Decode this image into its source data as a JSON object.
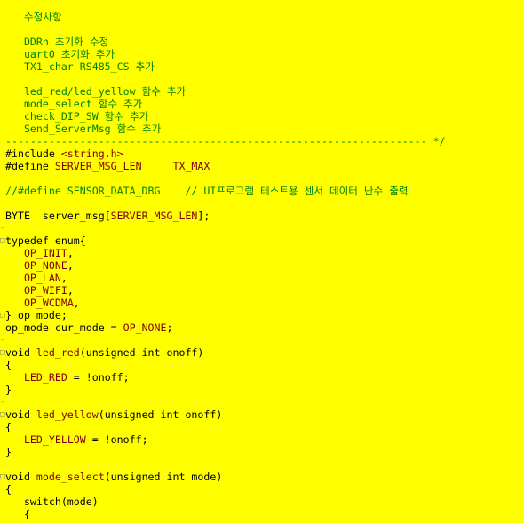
{
  "editor": {
    "background": "#ffff00",
    "colors": {
      "comment": "#008000",
      "macro": "#800000",
      "plain": "#000000"
    },
    "lines": [
      {
        "segs": [
          [
            "   수정사항",
            "comment"
          ]
        ]
      },
      {
        "segs": []
      },
      {
        "segs": [
          [
            "   DDRn 초기화 수정",
            "comment"
          ]
        ]
      },
      {
        "segs": [
          [
            "   uart0 초기화 추가",
            "comment"
          ]
        ]
      },
      {
        "segs": [
          [
            "   TX1_char RS485_CS 추가",
            "comment"
          ]
        ]
      },
      {
        "segs": []
      },
      {
        "segs": [
          [
            "   led_red/led_yellow 함수 추가",
            "comment"
          ]
        ]
      },
      {
        "segs": [
          [
            "   mode_select 함수 추가",
            "comment"
          ]
        ]
      },
      {
        "segs": [
          [
            "   check_DIP_SW 함수 추가",
            "comment"
          ]
        ]
      },
      {
        "segs": [
          [
            "   Send_ServerMsg 함수 추가",
            "comment"
          ]
        ]
      },
      {
        "segs": [
          [
            "-------------------------------------------------------------------- */",
            "comment"
          ]
        ]
      },
      {
        "segs": [
          [
            "#include ",
            "plain"
          ],
          [
            "<string.h>",
            "macro"
          ]
        ]
      },
      {
        "segs": [
          [
            "#define ",
            "plain"
          ],
          [
            "SERVER_MSG_LEN",
            "macro"
          ],
          [
            "     ",
            "plain"
          ],
          [
            "TX_MAX",
            "macro"
          ]
        ]
      },
      {
        "segs": []
      },
      {
        "segs": [
          [
            "//#define SENSOR_DATA_DBG    // UI프로그램 테스트용 센서 데이터 난수 출력",
            "comment"
          ]
        ]
      },
      {
        "segs": []
      },
      {
        "segs": [
          [
            "BYTE  server_msg[",
            "plain"
          ],
          [
            "SERVER_MSG_LEN",
            "macro"
          ],
          [
            "];",
            "plain"
          ]
        ]
      },
      {
        "segs": [],
        "gutter": "-"
      },
      {
        "segs": [
          [
            "typedef enum{",
            "plain"
          ]
        ],
        "gutter": "□"
      },
      {
        "segs": [
          [
            "   ",
            "plain"
          ],
          [
            "OP_INIT",
            "macro"
          ],
          [
            ",",
            "plain"
          ]
        ]
      },
      {
        "segs": [
          [
            "   ",
            "plain"
          ],
          [
            "OP_NONE",
            "macro"
          ],
          [
            ",",
            "plain"
          ]
        ]
      },
      {
        "segs": [
          [
            "   ",
            "plain"
          ],
          [
            "OP_LAN",
            "macro"
          ],
          [
            ",",
            "plain"
          ]
        ]
      },
      {
        "segs": [
          [
            "   ",
            "plain"
          ],
          [
            "OP_WIFI",
            "macro"
          ],
          [
            ",",
            "plain"
          ]
        ]
      },
      {
        "segs": [
          [
            "   ",
            "plain"
          ],
          [
            "OP_WCDMA",
            "macro"
          ],
          [
            ",",
            "plain"
          ]
        ]
      },
      {
        "segs": [
          [
            "} op_mode;",
            "plain"
          ]
        ],
        "gutter": "□"
      },
      {
        "segs": [
          [
            "op_mode cur_mode = ",
            "plain"
          ],
          [
            "OP_NONE",
            "macro"
          ],
          [
            ";",
            "plain"
          ]
        ]
      },
      {
        "segs": [],
        "gutter": "-"
      },
      {
        "segs": [
          [
            "void ",
            "plain"
          ],
          [
            "led_red",
            "macro"
          ],
          [
            "(unsigned int onoff)",
            "plain"
          ]
        ],
        "gutter": "□"
      },
      {
        "segs": [
          [
            "{",
            "plain"
          ]
        ]
      },
      {
        "segs": [
          [
            "   ",
            "plain"
          ],
          [
            "LED_RED",
            "macro"
          ],
          [
            " = !onoff;",
            "plain"
          ]
        ]
      },
      {
        "segs": [
          [
            "}",
            "plain"
          ]
        ]
      },
      {
        "segs": [],
        "gutter": "-"
      },
      {
        "segs": [
          [
            "void ",
            "plain"
          ],
          [
            "led_yellow",
            "macro"
          ],
          [
            "(unsigned int onoff)",
            "plain"
          ]
        ],
        "gutter": "□"
      },
      {
        "segs": [
          [
            "{",
            "plain"
          ]
        ]
      },
      {
        "segs": [
          [
            "   ",
            "plain"
          ],
          [
            "LED_YELLOW",
            "macro"
          ],
          [
            " = !onoff;",
            "plain"
          ]
        ]
      },
      {
        "segs": [
          [
            "}",
            "plain"
          ]
        ]
      },
      {
        "segs": [],
        "gutter": "-"
      },
      {
        "segs": [
          [
            "void ",
            "plain"
          ],
          [
            "mode_select",
            "macro"
          ],
          [
            "(unsigned int mode)",
            "plain"
          ]
        ],
        "gutter": "□"
      },
      {
        "segs": [
          [
            "{",
            "plain"
          ]
        ]
      },
      {
        "segs": [
          [
            "   switch(mode)",
            "plain"
          ]
        ]
      },
      {
        "segs": [
          [
            "   {",
            "plain"
          ]
        ]
      }
    ]
  }
}
